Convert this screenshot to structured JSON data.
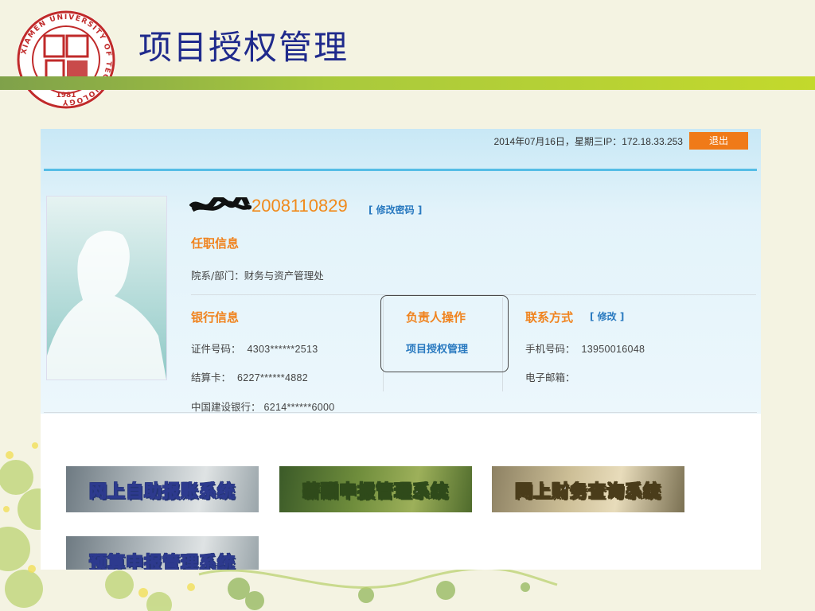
{
  "slide": {
    "title": "项目授权管理"
  },
  "logo": {
    "ring_text": "XIAMEN UNIVERSITY OF TECHNOLOGY",
    "year": "1981"
  },
  "portal": {
    "datetime": "2014年07月16日，星期三IP：172.18.33.253",
    "logout_label": "退出",
    "user": {
      "id": "2008110829",
      "change_password": "[ 修改密码 ]"
    },
    "employment": {
      "heading": "任职信息",
      "dept_label": "院系/部门：",
      "dept_value": "财务与资产管理处"
    },
    "bank": {
      "heading": "银行信息",
      "id_label": "证件号码：",
      "id_value": "4303******2513",
      "card_label": "结算卡：",
      "card_value": "6227******4882",
      "ccb_label": "中国建设银行：",
      "ccb_value": "6214******6000"
    },
    "manager": {
      "heading": "负责人操作",
      "link": "项目授权管理"
    },
    "contact": {
      "heading": "联系方式",
      "edit": "[ 修改 ]",
      "phone_label": "手机号码：",
      "phone_value": "13950016048",
      "email_label": "电子邮箱："
    },
    "systems": [
      {
        "label": "网上自助报账系统"
      },
      {
        "label": "薪酬申报管理系统"
      },
      {
        "label": "网上财务查询系统"
      },
      {
        "label": "预算申报管理系统"
      }
    ]
  },
  "colors": {
    "accent_orange": "#f0831e",
    "title_blue": "#1f2a8c",
    "link_blue": "#2a7ac0",
    "band_green": "#a9c93d"
  }
}
